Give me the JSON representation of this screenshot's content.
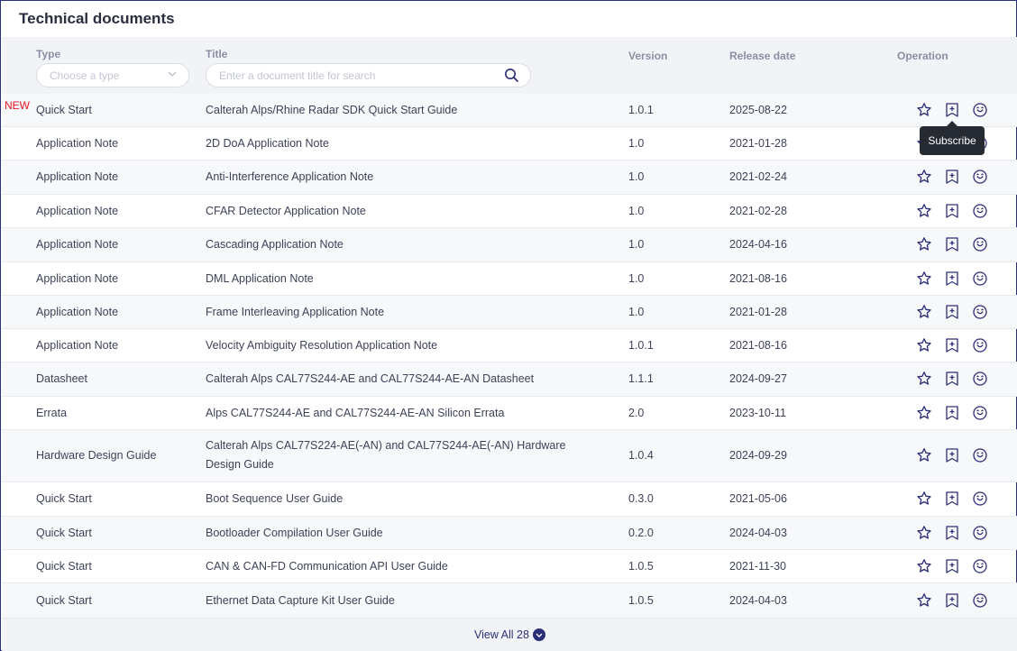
{
  "page": {
    "title": "Technical documents"
  },
  "filters": {
    "type_label": "Type",
    "type_placeholder": "Choose a type",
    "title_label": "Title",
    "title_placeholder": "Enter a document title for search"
  },
  "columns": {
    "version": "Version",
    "release_date": "Release date",
    "operation": "Operation"
  },
  "new_badge": "NEW",
  "rows": [
    {
      "type": "Quick Start",
      "title": "Calterah Alps/Rhine Radar SDK Quick Start Guide",
      "version": "1.0.1",
      "date": "2025-08-22",
      "is_new": true
    },
    {
      "type": "Application Note",
      "title": "2D DoA Application Note",
      "version": "1.0",
      "date": "2021-01-28"
    },
    {
      "type": "Application Note",
      "title": "Anti-Interference Application Note",
      "version": "1.0",
      "date": "2021-02-24"
    },
    {
      "type": "Application Note",
      "title": "CFAR Detector Application Note",
      "version": "1.0",
      "date": "2021-02-28"
    },
    {
      "type": "Application Note",
      "title": "Cascading Application Note",
      "version": "1.0",
      "date": "2024-04-16"
    },
    {
      "type": "Application Note",
      "title": "DML Application Note",
      "version": "1.0",
      "date": "2021-08-16"
    },
    {
      "type": "Application Note",
      "title": "Frame Interleaving Application Note",
      "version": "1.0",
      "date": "2021-01-28"
    },
    {
      "type": "Application Note",
      "title": "Velocity Ambiguity Resolution Application Note",
      "version": "1.0.1",
      "date": "2021-08-16"
    },
    {
      "type": "Datasheet",
      "title": "Calterah Alps CAL77S244-AE and CAL77S244-AE-AN Datasheet",
      "version": "1.1.1",
      "date": "2024-09-27"
    },
    {
      "type": "Errata",
      "title": "Alps CAL77S244-AE and CAL77S244-AE-AN Silicon Errata",
      "version": "2.0",
      "date": "2023-10-11"
    },
    {
      "type": "Hardware Design Guide",
      "title": "Calterah Alps CAL77S224-AE(-AN) and CAL77S244-AE(-AN) Hardware Design Guide",
      "version": "1.0.4",
      "date": "2024-09-29"
    },
    {
      "type": "Quick Start",
      "title": "Boot Sequence User Guide",
      "version": "0.3.0",
      "date": "2021-05-06"
    },
    {
      "type": "Quick Start",
      "title": "Bootloader Compilation User Guide",
      "version": "0.2.0",
      "date": "2024-04-03"
    },
    {
      "type": "Quick Start",
      "title": "CAN & CAN-FD Communication API User Guide",
      "version": "1.0.5",
      "date": "2021-11-30"
    },
    {
      "type": "Quick Start",
      "title": "Ethernet Data Capture Kit User Guide",
      "version": "1.0.5",
      "date": "2024-04-03"
    }
  ],
  "operations": {
    "icons": [
      "star-icon",
      "subscribe-icon",
      "feedback-icon"
    ]
  },
  "tooltip": "Subscribe",
  "footer": {
    "view_all": "View All 28"
  },
  "colors": {
    "accent": "#2b2f78",
    "new": "#e5151e",
    "header_bg": "#f2f3f7"
  }
}
